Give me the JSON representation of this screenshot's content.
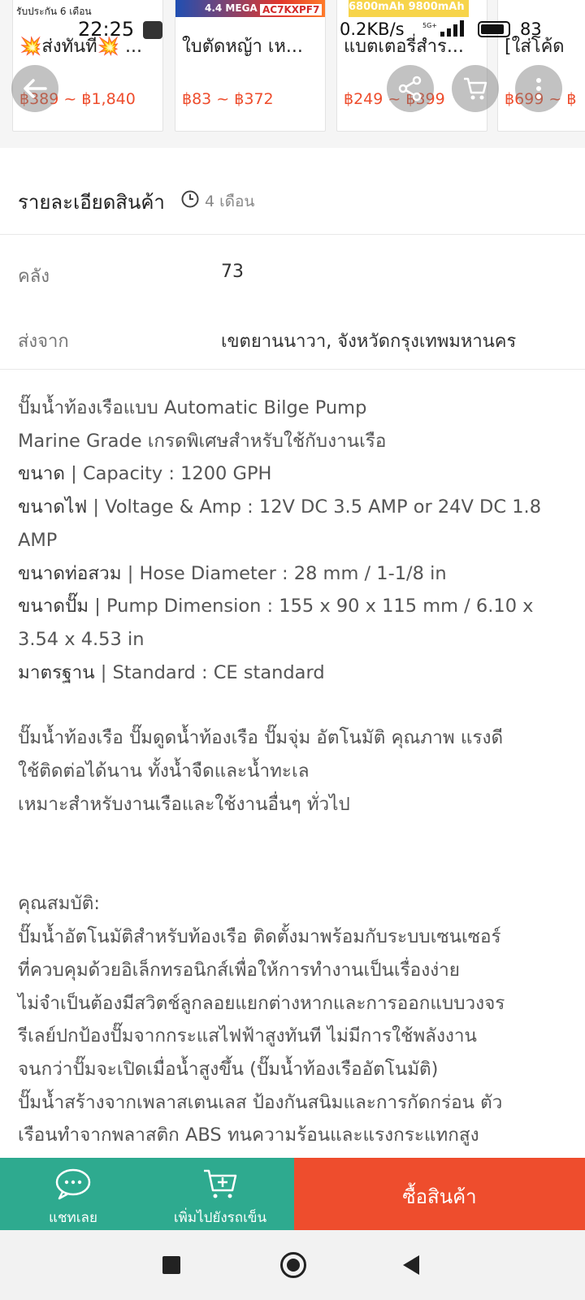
{
  "related_products": [
    {
      "name": "💥ส่งทันที💥 ...",
      "price": "฿389 ~ ฿1,840",
      "banner_text": "รับประกัน 6 เดือน"
    },
    {
      "name": "ใบตัดหญ้า เห...",
      "price": "฿83 ~ ฿372",
      "banner_text": "4.4 MEGA",
      "code": "AC7KXPF7"
    },
    {
      "name": "แบตเตอรี่สำร...",
      "price": "฿249 ~ ฿399",
      "banner_text": "6800mAh 9800mAh"
    },
    {
      "name": "[ใส่โค้ด",
      "price": "฿699 ~ ฿"
    }
  ],
  "status_bar": {
    "time": "22:25",
    "network": "0.2KB/s",
    "battery": "83"
  },
  "icons": {
    "back": "arrow-left-icon",
    "share": "share-icon",
    "cart": "cart-icon",
    "more": "more-vertical-icon",
    "clock": "clock-icon",
    "chat": "chat-icon",
    "add_cart": "cart-plus-icon"
  },
  "details": {
    "title": "รายละเอียดสินค้า",
    "age": "4 เดือน",
    "specs": [
      {
        "label": "คลัง",
        "value": "73"
      },
      {
        "label": "ส่งจาก",
        "value": "เขตยานนาวา, จังหวัดกรุงเทพมหานคร"
      }
    ],
    "description": {
      "line1": "ปั๊มน้ำท้องเรือแบบ Automatic Bilge Pump",
      "line2": "Marine Grade เกรดพิเศษสำหรับใช้กับงานเรือ",
      "cap_label": "ขนาด",
      "cap_value": " | Capacity : 1200 GPH",
      "volt_label": "ขนาดไฟ",
      "volt_value": " | Voltage & Amp : 12V DC 3.5 AMP or 24V DC 1.8",
      "volt_cont": "AMP",
      "hose_label": "ขนาดท่อสวม",
      "hose_value": " | Hose Diameter : 28 mm / 1-1/8 in",
      "pump_label": "ขนาดปั๊ม",
      "pump_value": " | Pump Dimension : 155 x 90 x 115 mm / 6.10 x",
      "pump_cont": "3.54 x 4.53 in",
      "std_label": "มาตรฐาน",
      "std_value": " | Standard : CE standard",
      "para2_1": "ปั๊มน้ำท้องเรือ ปั๊มดูดน้ำท้องเรือ ปั๊มจุ่ม อัตโนมัติ คุณภาพ แรงดี",
      "para2_2": "ใช้ติดต่อได้นาน ทั้งน้ำจืดและน้ำทะเล",
      "para2_3": "เหมาะสำหรับงานเรือและใช้งานอื่นๆ ทั่วไป",
      "props_title": "คุณสมบัติ:",
      "props_1": " ปั๊มน้ำอัตโนมัติสำหรับท้องเรือ ติดตั้งมาพร้อมกับระบบเซนเซอร์",
      "props_2": "ที่ควบคุมด้วยอิเล็กทรอนิกส์เพื่อให้การทำงานเป็นเรื่องง่าย",
      "props_3": " ไม่จำเป็นต้องมีสวิตช์ลูกลอยแยกต่างหากและการออกแบบวงจร",
      "props_4": "รีเลย์ปกป้องปั๊มจากกระแสไฟฟ้าสูงทันที ไม่มีการใช้พลังงาน",
      "props_5": "จนกว่าปั๊มจะเปิดเมื่อน้ำสูงขึ้น (ปั๊มน้ำท้องเรืออัตโนมัติ)",
      "props_6": " ปั๊มน้ำสร้างจากเพลาสเตนเลส ป้องกันสนิมและการกัดกร่อน ตัว",
      "props_7": "เรือนทำจากพลาสติก ABS ทนความร้อนและแรงกระแทกสูง"
    }
  },
  "actions": {
    "chat": "แชทเลย",
    "add_to_cart": "เพิ่มไปยังรถเข็น",
    "buy": "ซื้อสินค้า"
  },
  "colors": {
    "accent_green": "#2eaa8f",
    "accent_orange": "#ee4d2d"
  }
}
